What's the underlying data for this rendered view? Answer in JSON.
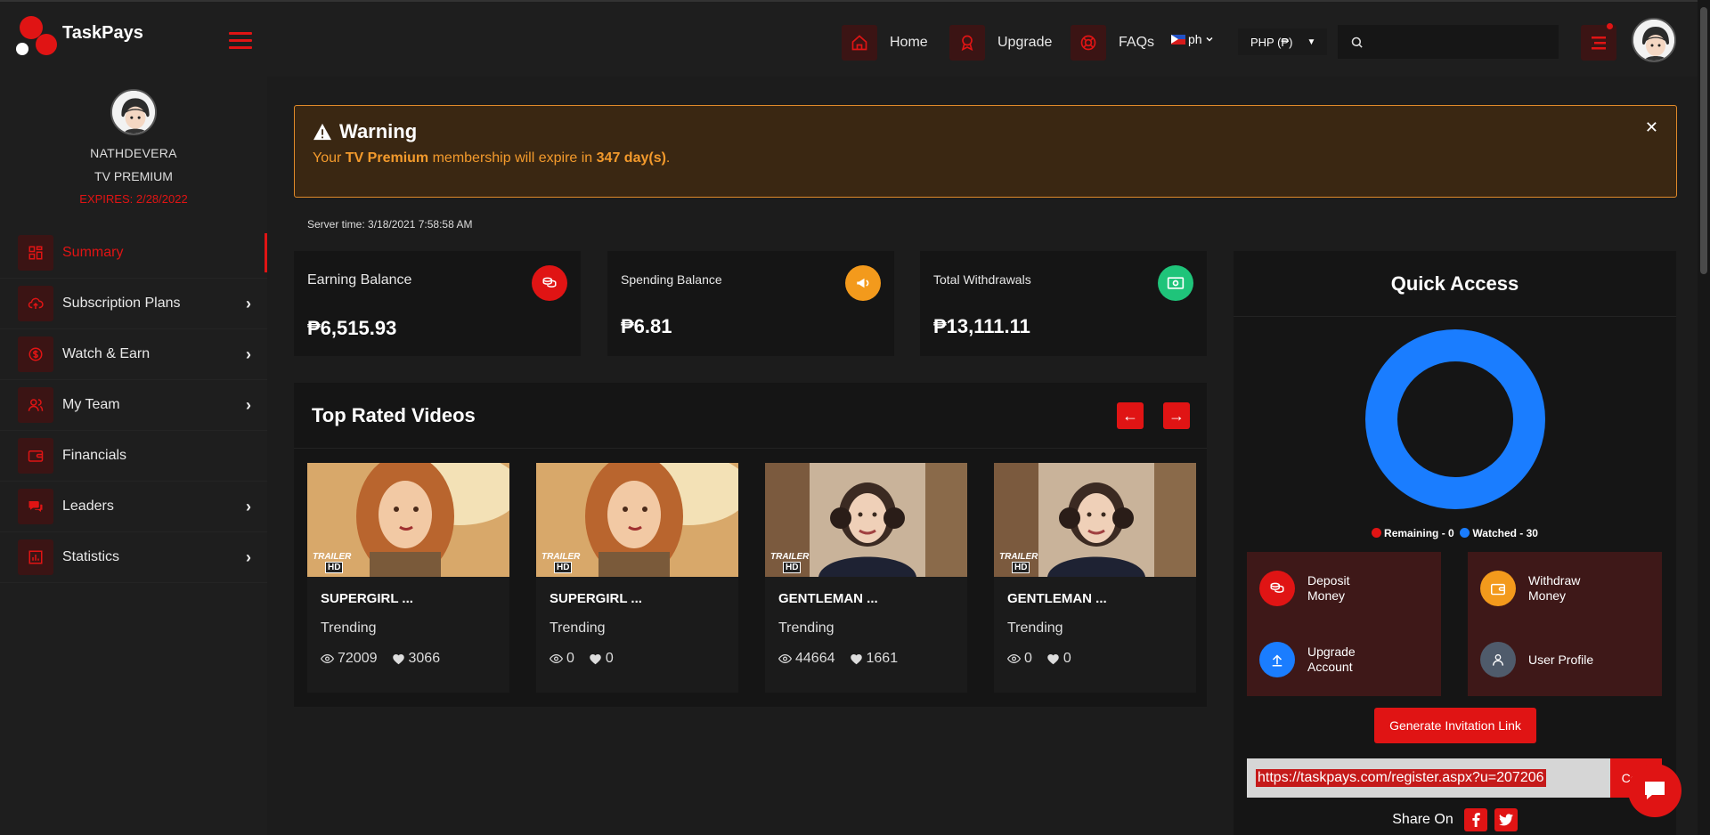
{
  "app": {
    "name": "TaskPays"
  },
  "nav": {
    "home": "Home",
    "upgrade": "Upgrade",
    "faqs": "FAQs",
    "language": "ph",
    "currency": "PHP (₱)",
    "search_placeholder": ""
  },
  "profile": {
    "username": "NATHDEVERA",
    "plan": "TV PREMIUM",
    "expires": "EXPIRES: 2/28/2022"
  },
  "sidebar": {
    "items": [
      {
        "label": "Summary",
        "icon": "summary-icon",
        "active": true,
        "chevron": false
      },
      {
        "label": "Subscription Plans",
        "icon": "cloud-upload-icon",
        "chevron": true
      },
      {
        "label": "Watch & Earn",
        "icon": "dollar-icon",
        "chevron": true
      },
      {
        "label": "My Team",
        "icon": "team-icon",
        "chevron": true
      },
      {
        "label": "Financials",
        "icon": "wallet-icon",
        "chevron": false
      },
      {
        "label": "Leaders",
        "icon": "chat-bubbles-icon",
        "chevron": true
      },
      {
        "label": "Statistics",
        "icon": "bar-chart-icon",
        "chevron": true
      }
    ]
  },
  "warning": {
    "title": "Warning",
    "msg_prefix": "Your ",
    "membership": "TV Premium",
    "msg_middle": " membership will expire in ",
    "days": "347 day(s)",
    "msg_suffix": "."
  },
  "server_time": "Server time: 3/18/2021 7:58:58 AM",
  "stats": [
    {
      "label": "Earning Balance",
      "value": "₱6,515.93",
      "color": "#e01414"
    },
    {
      "label": "Spending Balance",
      "value": "₱6.81",
      "color": "#f39a1c"
    },
    {
      "label": "Total Withdrawals",
      "value": "₱13,111.11",
      "color": "#1fc47a"
    }
  ],
  "top_rated": {
    "title": "Top Rated Videos",
    "videos": [
      {
        "title": "SUPERGIRL ...",
        "category": "Trending",
        "views": "72009",
        "likes": "3066",
        "badge": "TRAILER",
        "quality": "HD"
      },
      {
        "title": "SUPERGIRL ...",
        "category": "Trending",
        "views": "0",
        "likes": "0",
        "badge": "TRAILER",
        "quality": "HD"
      },
      {
        "title": "GENTLEMAN ...",
        "category": "Trending",
        "views": "44664",
        "likes": "1661",
        "badge": "TRAILER",
        "quality": "HD"
      },
      {
        "title": "GENTLEMAN ...",
        "category": "Trending",
        "views": "0",
        "likes": "0",
        "badge": "TRAILER",
        "quality": "HD"
      }
    ]
  },
  "quick_access": {
    "title": "Quick Access",
    "legend_remaining": "Remaining - 0",
    "legend_watched": "Watched - 30",
    "remaining": 0,
    "watched": 30,
    "colors": {
      "remaining": "#e01414",
      "watched": "#1a7dff"
    },
    "buttons": {
      "deposit": "Deposit Money",
      "withdraw": "Withdraw Money",
      "upgrade": "Upgrade Account",
      "profile": "User Profile"
    },
    "generate": "Generate Invitation Link",
    "invite_link": "https://taskpays.com/register.aspx?u=207206",
    "copy": "Copy",
    "share_on": "Share On"
  }
}
